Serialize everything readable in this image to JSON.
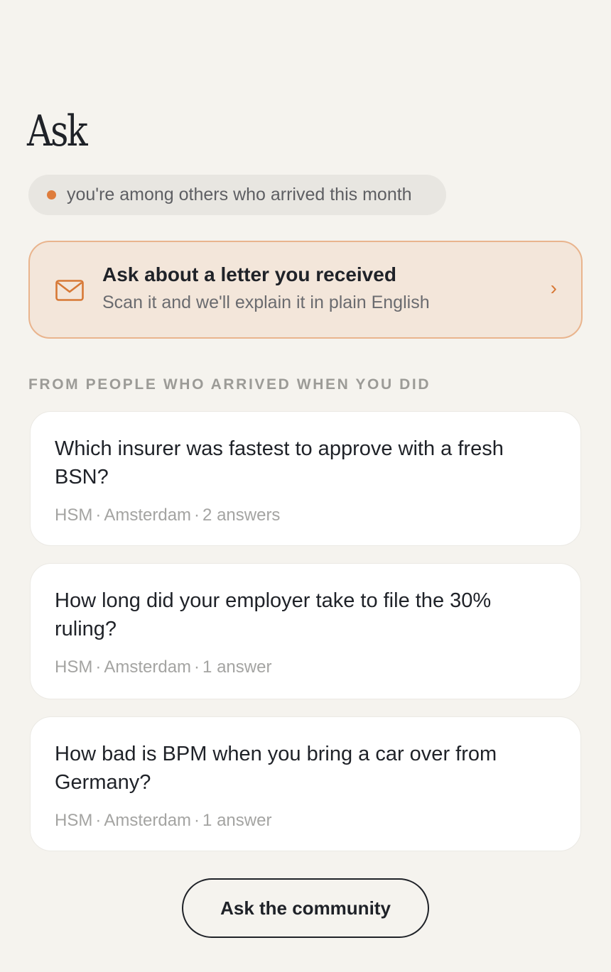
{
  "header": {
    "title": "Ask"
  },
  "cohort": {
    "text": "you're among others who arrived this month",
    "dot_color": "#de7c3c"
  },
  "letter_card": {
    "icon": "envelope-icon",
    "title": "Ask about a letter you received",
    "subtitle": "Scan it and we'll explain it in plain English",
    "chevron": "›",
    "accent_color": "#d77835"
  },
  "section": {
    "heading": "FROM PEOPLE WHO ARRIVED WHEN YOU DID"
  },
  "questions": [
    {
      "text": "Which insurer was fastest to approve with a fresh BSN?",
      "author": "HSM",
      "city": "Amsterdam",
      "answers": "2 answers"
    },
    {
      "text": "How long did your employer take to file the 30% ruling?",
      "author": "HSM",
      "city": "Amsterdam",
      "answers": "1 answer"
    },
    {
      "text": "How bad is BPM when you bring a car over from Germany?",
      "author": "HSM",
      "city": "Amsterdam",
      "answers": "1 answer"
    }
  ],
  "meta_separator": "·",
  "footer": {
    "ask_button_label": "Ask the community"
  }
}
